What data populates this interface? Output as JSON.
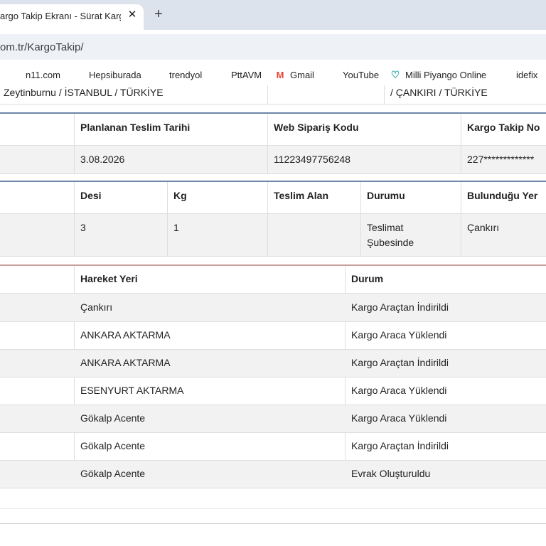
{
  "browser": {
    "tab_title": "argo Takip Ekranı - Sürat Kargo",
    "close_glyph": "✕",
    "new_tab_glyph": "+",
    "url": "om.tr/KargoTakip/"
  },
  "bookmarks": [
    {
      "label": "n11.com",
      "icon": "n11-icon",
      "color": "#6a1b9a",
      "glyph": "n"
    },
    {
      "label": "Hepsiburada",
      "icon": "hepsiburada-icon",
      "color": "#ff6000",
      "glyph": "hb"
    },
    {
      "label": "trendyol",
      "icon": "trendyol-icon",
      "color": "#f27a1a",
      "glyph": "t"
    },
    {
      "label": "PttAVM",
      "icon": "pttavm-icon",
      "color": "#1d3b8e",
      "glyph": "ptt"
    },
    {
      "label": "Gmail",
      "icon": "gmail-icon",
      "color": "#ea4335",
      "glyph": "M"
    },
    {
      "label": "YouTube",
      "icon": "youtube-icon",
      "color": "#ff0000",
      "glyph": "▶"
    },
    {
      "label": "Milli Piyango Online",
      "icon": "milli-piyango-icon",
      "color": "#2aa6a0",
      "glyph": "♡"
    },
    {
      "label": "idefix",
      "icon": "idefix-icon",
      "color": "#555555",
      "glyph": "◎"
    }
  ],
  "address_row": {
    "sender": "Zeytinburnu / İSTANBUL / TÜRKİYE",
    "receiver": "/ ÇANKIRI / TÜRKİYE"
  },
  "delivery_table": {
    "headers": [
      "Planlanan Teslim Tarihi",
      "Web Sipariş Kodu",
      "Kargo Takip No"
    ],
    "values": [
      "3.08.2026",
      "11223497756248",
      "227*************"
    ]
  },
  "package_table": {
    "headers": [
      "Desi",
      "Kg",
      "Teslim Alan",
      "Durumu",
      "Bulunduğu Yer"
    ],
    "values": {
      "desi": "3",
      "kg": "1",
      "teslim_alan": "",
      "durumu_line1": "Teslimat",
      "durumu_line2": "Şubesinde",
      "bulundugu_yer": "Çankırı"
    }
  },
  "movements": {
    "headers": [
      "Hareket Yeri",
      "Durum"
    ],
    "rows": [
      {
        "yer": "Çankırı",
        "durum": "Kargo Araçtan İndirildi"
      },
      {
        "yer": "ANKARA AKTARMA",
        "durum": "Kargo Araca Yüklendi"
      },
      {
        "yer": "ANKARA AKTARMA",
        "durum": "Kargo Araçtan İndirildi"
      },
      {
        "yer": "ESENYURT AKTARMA",
        "durum": "Kargo Araca Yüklendi"
      },
      {
        "yer": "Gökalp Acente",
        "durum": "Kargo Araca Yüklendi"
      },
      {
        "yer": "Gökalp Acente",
        "durum": "Kargo Araçtan İndirildi"
      },
      {
        "yer": "Gökalp Acente",
        "durum": "Evrak Oluşturuldu"
      }
    ]
  },
  "colors": {
    "tabstrip": "#dde3ec",
    "row_shade": "#f2f2f2",
    "table_top_border_blue": "#6e87a8",
    "table_top_border_red": "#c9a09a"
  }
}
